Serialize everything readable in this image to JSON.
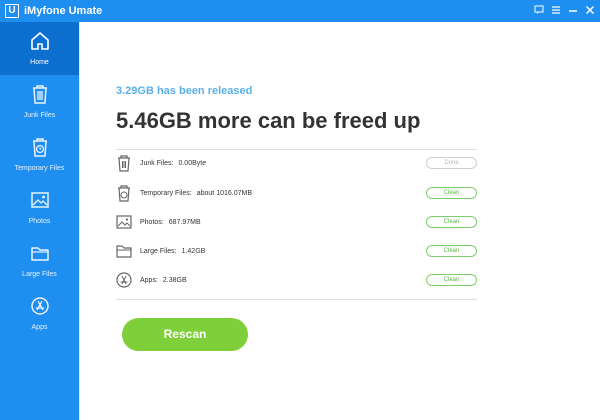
{
  "window": {
    "title": "iMyfone Umate",
    "logo_letter": "U"
  },
  "sidebar": {
    "items": [
      {
        "label": "Home",
        "icon": "home-icon",
        "active": true
      },
      {
        "label": "Junk Files",
        "icon": "trash-icon",
        "active": false
      },
      {
        "label": "Temporary Files",
        "icon": "temp-trash-icon",
        "active": false
      },
      {
        "label": "Photos",
        "icon": "photo-icon",
        "active": false
      },
      {
        "label": "Large Files",
        "icon": "folder-icon",
        "active": false
      },
      {
        "label": "Apps",
        "icon": "app-store-icon",
        "active": false
      }
    ]
  },
  "main": {
    "released_text": "3.29GB has been released",
    "headline": "5.46GB more can be freed up",
    "rows": [
      {
        "label": "Junk Files:",
        "value": "0.00Byte",
        "button": "Done",
        "status": "done",
        "icon": "trash-icon"
      },
      {
        "label": "Temporary Files:",
        "value": "about 1016.07MB",
        "button": "Clean",
        "status": "clean",
        "icon": "temp-trash-icon"
      },
      {
        "label": "Photos:",
        "value": "687.97MB",
        "button": "Clean",
        "status": "clean",
        "icon": "photo-icon"
      },
      {
        "label": "Large Files:",
        "value": "1.42GB",
        "button": "Clean",
        "status": "clean",
        "icon": "folder-icon"
      },
      {
        "label": "Apps:",
        "value": "2.38GB",
        "button": "Clean",
        "status": "clean",
        "icon": "app-store-icon"
      }
    ],
    "rescan_label": "Rescan"
  },
  "colors": {
    "sidebar_blue": "#1f8ef1",
    "active_blue": "#0d6fd0",
    "released_blue": "#5cb0e8",
    "green": "#7ecf3a",
    "clean_green": "#5ab646"
  }
}
